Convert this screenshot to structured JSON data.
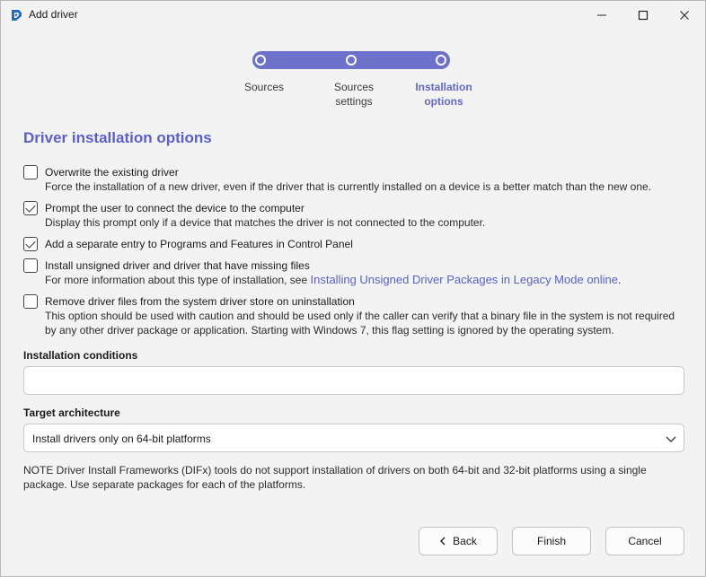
{
  "window": {
    "title": "Add driver",
    "app_icon": "advanced-installer-icon"
  },
  "stepper": {
    "steps": [
      {
        "label_line1": "Sources",
        "label_line2": "",
        "active": false
      },
      {
        "label_line1": "Sources",
        "label_line2": "settings",
        "active": false
      },
      {
        "label_line1": "Installation",
        "label_line2": "options",
        "active": true
      }
    ]
  },
  "page_title": "Driver installation options",
  "options": [
    {
      "label": "Overwrite the existing driver",
      "description": "Force the installation of a new driver, even if the driver that is currently installed on a device is a better match than the new one.",
      "checked": false
    },
    {
      "label": "Prompt the user to connect the device to the computer",
      "description": "Display this prompt only if a device that matches the driver is not connected to the computer.",
      "checked": true
    },
    {
      "label": "Add a separate entry to Programs and Features in Control Panel",
      "description": "",
      "checked": true
    },
    {
      "label": "Install unsigned driver and driver that have missing files",
      "description_prefix": "For more information about this type of installation, see ",
      "description_link": "Installing Unsigned Driver Packages in Legacy Mode online",
      "description_suffix": ".",
      "checked": false
    },
    {
      "label": "Remove driver files from the system driver store on uninstallation",
      "description": "This option should be used with caution and should be used only if the caller can verify that a binary file in the system is not required by any other driver package or application. Starting with Windows 7, this flag setting is ignored by the operating system.",
      "checked": false
    }
  ],
  "installation_conditions": {
    "label": "Installation conditions",
    "value": ""
  },
  "target_architecture": {
    "label": "Target architecture",
    "selected": "Install drivers only on 64-bit platforms"
  },
  "note": "NOTE Driver Install Frameworks (DIFx) tools do not support installation of drivers on both 64-bit and 32-bit platforms using a single package. Use separate packages for each of the platforms.",
  "buttons": {
    "back": "Back",
    "finish": "Finish",
    "cancel": "Cancel"
  },
  "colors": {
    "accent": "#5b60c4",
    "stepper": "#6d71c9"
  }
}
